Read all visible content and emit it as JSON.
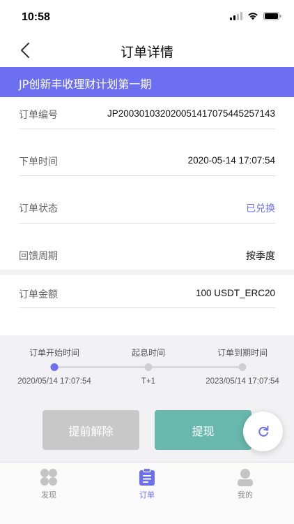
{
  "status_bar": {
    "time": "10:58"
  },
  "nav": {
    "title": "订单详情"
  },
  "plan": {
    "name": "JP创新丰收理财计划第一期"
  },
  "details": [
    {
      "label": "订单编号",
      "value": "JP200301032020051417075445257143"
    },
    {
      "label": "下单时间",
      "value": "2020-05-14 17:07:54"
    },
    {
      "label": "订单状态",
      "value": "已兑换"
    },
    {
      "label": "回馈周期",
      "value": "按季度"
    }
  ],
  "amount": {
    "label": "订单金额",
    "value": "100 USDT_ERC20"
  },
  "timeline": {
    "start": {
      "label": "订单开始时间",
      "date": "2020/05/14 17:07:54"
    },
    "interest": {
      "label": "起息时间",
      "date": "T+1"
    },
    "end": {
      "label": "订单到期时间",
      "date": "2023/05/14 17:07:54"
    }
  },
  "actions": {
    "early_cancel": "提前解除",
    "withdraw": "提现"
  },
  "tabs": [
    {
      "label": "发现",
      "icon": "discover-icon"
    },
    {
      "label": "订单",
      "icon": "order-icon"
    },
    {
      "label": "我的",
      "icon": "profile-icon"
    }
  ],
  "colors": {
    "accent": "#6c70f0",
    "withdraw": "#68b8ad",
    "disabled": "#c8c8c8"
  }
}
